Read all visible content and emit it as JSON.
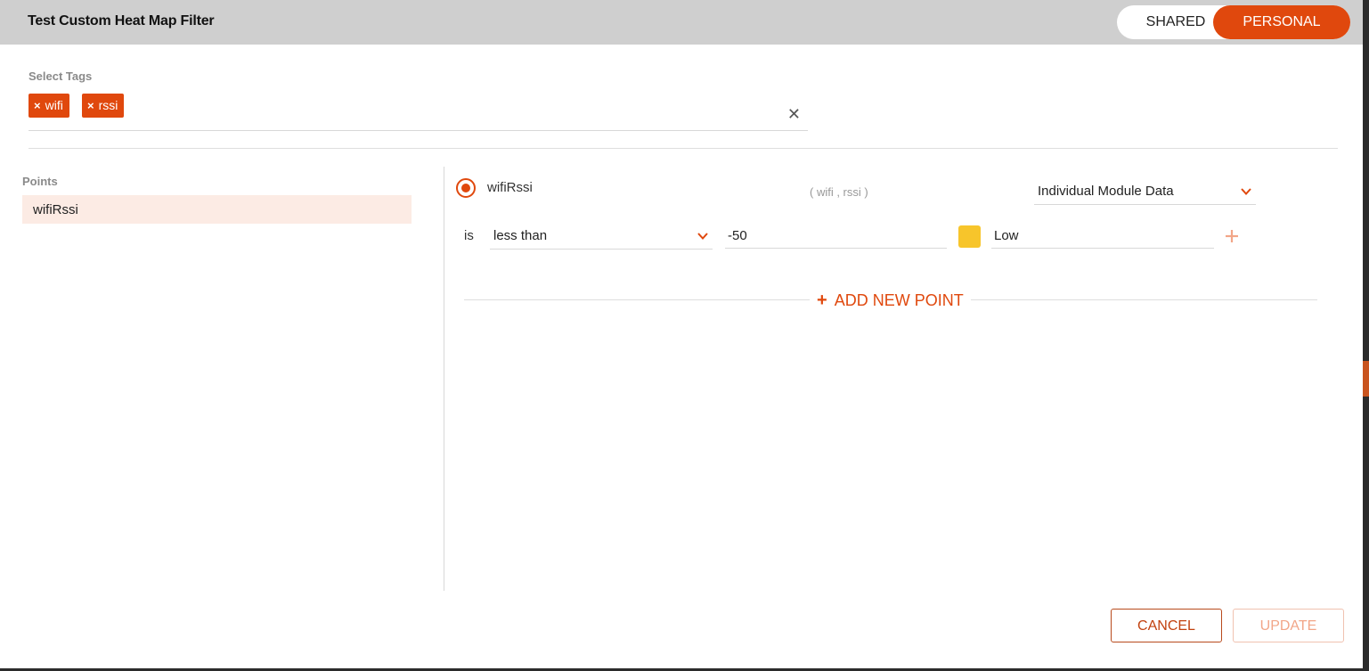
{
  "header": {
    "title": "Test Custom Heat Map Filter",
    "toggle": {
      "shared_label": "SHARED",
      "personal_label": "PERSONAL",
      "selected": "PERSONAL"
    }
  },
  "tags_field": {
    "label": "Select Tags",
    "tags": [
      "wifi",
      "rssi"
    ],
    "remove_glyph": "×",
    "clear_glyph": "✕"
  },
  "points_panel": {
    "label": "Points",
    "items": [
      "wifiRssi"
    ]
  },
  "point_detail": {
    "name": "wifiRssi",
    "tags_text": "( wifi , rssi )",
    "data_source_value": "Individual Module Data",
    "condition": {
      "is_label": "is",
      "operator_value": "less than",
      "threshold_value": "-50",
      "color": "#f7c52b",
      "level_value": "Low"
    },
    "add_new_point_label": "ADD NEW POINT"
  },
  "footer": {
    "cancel_label": "CANCEL",
    "update_label": "UPDATE"
  },
  "colors": {
    "accent": "#e0480d",
    "header_bg": "#cfcfcf",
    "selected_row_bg": "#fcebe4"
  }
}
